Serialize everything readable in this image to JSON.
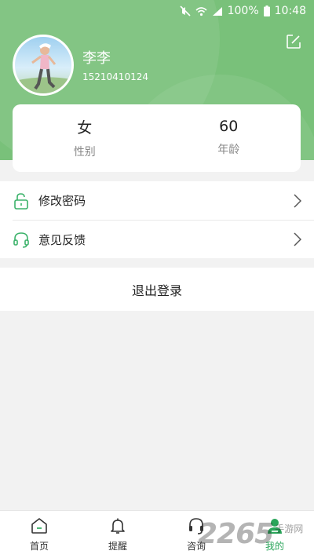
{
  "status_bar": {
    "battery": "100%",
    "time": "10:48",
    "icons": [
      "mute-icon",
      "wifi-icon",
      "signal-icon",
      "battery-icon"
    ]
  },
  "profile": {
    "name": "李李",
    "phone": "15210410124",
    "edit_icon": "edit-icon"
  },
  "info": {
    "gender_value": "女",
    "gender_label": "性别",
    "age_value": "60",
    "age_label": "年龄"
  },
  "menu": {
    "items": [
      {
        "label": "修改密码",
        "icon": "unlock-icon"
      },
      {
        "label": "意见反馈",
        "icon": "headset-icon"
      }
    ]
  },
  "logout": {
    "label": "退出登录"
  },
  "tabbar": {
    "tabs": [
      {
        "label": "首页",
        "icon": "home-icon"
      },
      {
        "label": "提醒",
        "icon": "bell-icon"
      },
      {
        "label": "咨询",
        "icon": "headset-icon"
      },
      {
        "label": "我的",
        "icon": "user-icon",
        "active": true
      }
    ]
  },
  "watermark": {
    "number": "2265",
    "site": "手游网"
  },
  "colors": {
    "header": "#79c17a",
    "accent": "#2aa55a",
    "icon_green": "#3bb26a",
    "background": "#f2f2f2"
  }
}
